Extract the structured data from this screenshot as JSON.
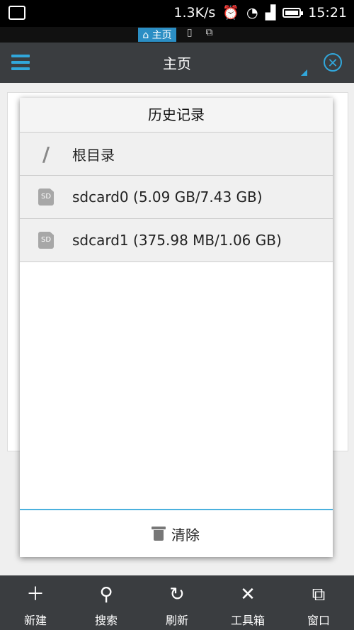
{
  "status_bar": {
    "speed": "1.3K/s",
    "time": "15:21"
  },
  "tabs": {
    "home": "主页"
  },
  "header": {
    "title": "主页"
  },
  "dialog": {
    "title": "历史记录",
    "items": [
      {
        "icon": "slash-icon",
        "label": "根目录"
      },
      {
        "icon": "sd-card-icon",
        "label": "sdcard0 (5.09 GB/7.43 GB)"
      },
      {
        "icon": "sd-card-icon",
        "label": "sdcard1 (375.98 MB/1.06 GB)"
      }
    ],
    "footer_label": "清除"
  },
  "bottom_bar": {
    "items": [
      {
        "icon": "plus-icon",
        "label": "新建"
      },
      {
        "icon": "search-icon",
        "label": "搜索"
      },
      {
        "icon": "refresh-icon",
        "label": "刷新"
      },
      {
        "icon": "tools-icon",
        "label": "工具箱"
      },
      {
        "icon": "windows-icon",
        "label": "窗口"
      }
    ]
  },
  "colors": {
    "accent": "#31a7db",
    "header_bg": "#3a3d40"
  }
}
